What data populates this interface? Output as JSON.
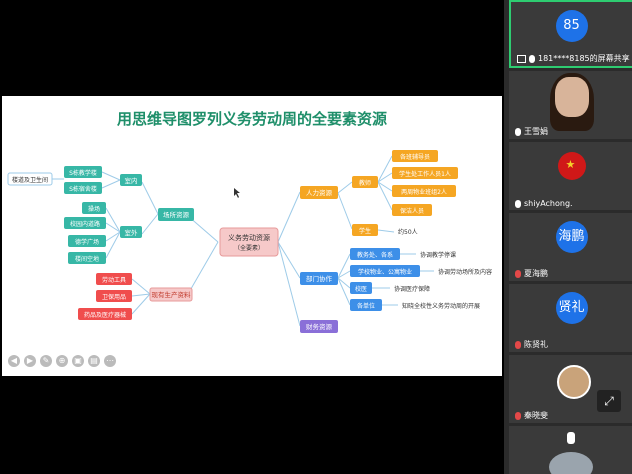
{
  "slide": {
    "title": "用思维导图罗列义务劳动周的全要素资源"
  },
  "mindmap": {
    "center": {
      "line1": "义务劳动资源",
      "line2": "（全要素）"
    },
    "scene": {
      "label": "场所资源",
      "outside": {
        "label": "楼道及卫生间",
        "items": [
          "S栋教学楼",
          "S栋宿舍楼"
        ]
      },
      "indoor": {
        "label": "室内"
      },
      "outdoor": {
        "label": "室外",
        "items": [
          "操场",
          "校园内道路",
          "德学广场",
          "楼间空地"
        ]
      }
    },
    "existing": {
      "label": "现有生产资料",
      "items": [
        "劳动工具",
        "卫保用品",
        "药品及医疗器械"
      ]
    },
    "human": {
      "label": "人力资源",
      "teacher": {
        "label": "教师",
        "items": [
          "各班辅导员",
          "学生处工作人员1人",
          "两周物业班组2人",
          "保洁人员"
        ]
      },
      "student": {
        "label": "学生",
        "note": "约50人"
      }
    },
    "dept": {
      "label": "部门协作",
      "items": [
        {
          "label": "教务处、各系",
          "note": "协调教学停课"
        },
        {
          "label": "学校物业、公寓物业",
          "note": "协调劳动场所及内容"
        },
        {
          "label": "校医",
          "note": "协调医疗保障"
        },
        {
          "label": "各单位",
          "note": "知晓全校性义务劳动周的开展"
        }
      ]
    },
    "finance": {
      "label": "财务资源"
    }
  },
  "participants": [
    {
      "name": "181****8185的屏幕共享",
      "avatar_text": "85",
      "type": "initials",
      "muted": false
    },
    {
      "name": "王雪娟",
      "type": "photo",
      "muted": false
    },
    {
      "name": "shiyAchong.",
      "type": "flag",
      "muted": false
    },
    {
      "name": "夏海鹏",
      "avatar_text": "海鹏",
      "type": "initials",
      "muted": true
    },
    {
      "name": "陈贤礼",
      "avatar_text": "贤礼",
      "type": "initials",
      "muted": true
    },
    {
      "name": "秦晓斐",
      "type": "cat",
      "muted": true
    }
  ],
  "colors": {
    "orange": "#f5a623",
    "green": "#5cc46a",
    "teal": "#37b7a6",
    "blue": "#3d8fe8",
    "purple": "#8a6fd8",
    "red": "#f04d4d",
    "pink": "#f6c9c9",
    "zoom_blue": "#1e72e8"
  }
}
